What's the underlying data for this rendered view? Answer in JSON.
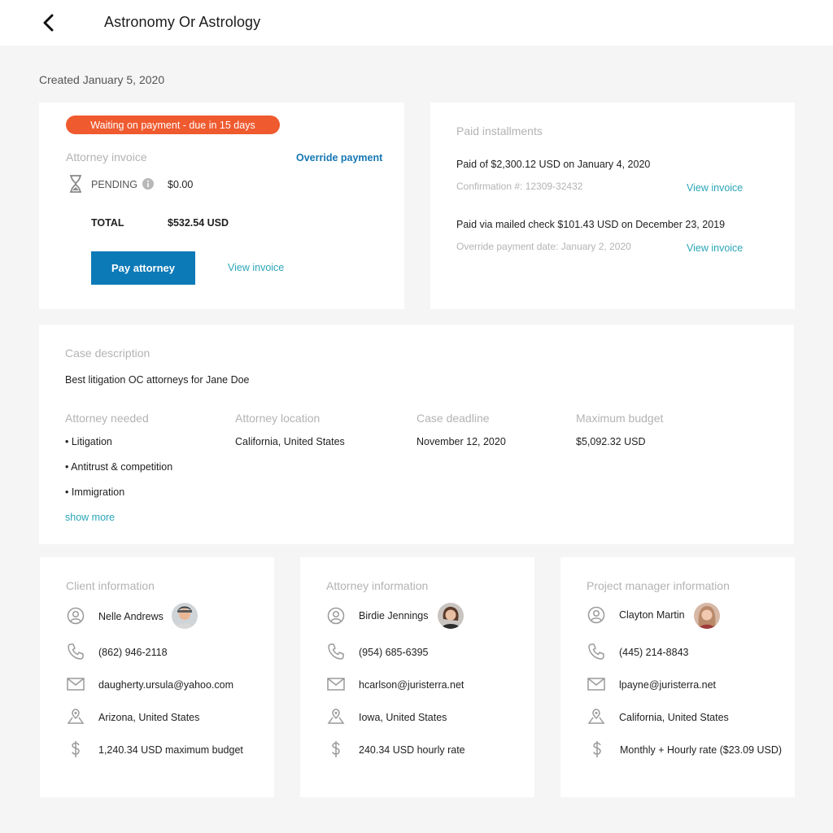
{
  "header": {
    "title": "Astronomy Or Astrology"
  },
  "created": "Created January 5, 2020",
  "invoice_card": {
    "status_badge": "Waiting on payment - due in 15 days",
    "section_title": "Attorney invoice",
    "override_label": "Override payment",
    "pending_label": "PENDING",
    "pending_amount": "$0.00",
    "total_label": "TOTAL",
    "total_amount": "$532.54 USD",
    "pay_button": "Pay attorney",
    "view_invoice": "View invoice"
  },
  "installments": {
    "title": "Paid installments",
    "items": [
      {
        "text": "Paid of $2,300.12 USD on January 4, 2020",
        "sub": "Confirmation #: 12309-32432",
        "link": "View invoice"
      },
      {
        "text": "Paid via mailed check $101.43 USD on December 23, 2019",
        "sub": "Override payment date: January 2, 2020",
        "link": "View invoice"
      }
    ]
  },
  "case": {
    "title": "Case description",
    "description": "Best litigation OC attorneys for Jane Doe",
    "attorney_needed_label": "Attorney needed",
    "attorney_needed": [
      "• Litigation",
      "• Antitrust & competition",
      "• Immigration"
    ],
    "show_more": "show more",
    "location_label": "Attorney location",
    "location": "California, United States",
    "deadline_label": "Case deadline",
    "deadline": "November 12, 2020",
    "budget_label": "Maximum budget",
    "budget": "$5,092.32 USD"
  },
  "client": {
    "title": "Client information",
    "name": "Nelle Andrews",
    "phone": "(862) 946-2118",
    "email": "daugherty.ursula@yahoo.com",
    "location": "Arizona, United States",
    "budget": "1,240.34 USD maximum budget"
  },
  "attorney": {
    "title": "Attorney information",
    "name": "Birdie Jennings",
    "phone": "(954) 685-6395",
    "email": "hcarlson@juristerra.net",
    "location": "Iowa, United States",
    "rate": "240.34 USD hourly rate"
  },
  "manager": {
    "title": "Project manager information",
    "name": "Clayton Martin",
    "phone": "(445) 214-8843",
    "email": "lpayne@juristerra.net",
    "location": "California, United States",
    "rate": "Monthly + Hourly rate ($23.09 USD)"
  },
  "colors": {
    "accent": "#0d7ab8",
    "link": "#2aa6b8",
    "badge": "#ef5a2f"
  },
  "icons": [
    "back-arrow-icon",
    "hourglass-icon",
    "info-icon",
    "user-icon",
    "phone-icon",
    "mail-icon",
    "location-pin-icon",
    "dollar-icon"
  ]
}
